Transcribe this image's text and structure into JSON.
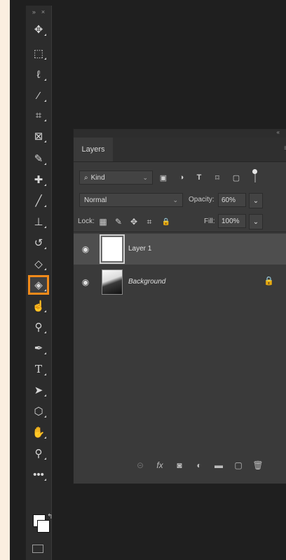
{
  "toolbar": {
    "collapse_glyph": "»",
    "close_glyph": "×",
    "tools": [
      {
        "name": "move-tool",
        "icon": "move-icon",
        "glyph": "✥"
      },
      {
        "name": "marquee-tool",
        "icon": "marquee-icon",
        "glyph": "⬚"
      },
      {
        "name": "lasso-tool",
        "icon": "lasso-icon",
        "glyph": "ℓ"
      },
      {
        "name": "magic-wand-tool",
        "icon": "magic-wand-icon",
        "glyph": "⁄"
      },
      {
        "name": "crop-tool",
        "icon": "crop-icon",
        "glyph": "⌗"
      },
      {
        "name": "frame-tool",
        "icon": "frame-icon",
        "glyph": "⊠"
      },
      {
        "name": "eyedropper-tool",
        "icon": "eyedropper-icon",
        "glyph": "✎"
      },
      {
        "name": "healing-brush-tool",
        "icon": "bandage-icon",
        "glyph": "✚"
      },
      {
        "name": "brush-tool",
        "icon": "brush-icon",
        "glyph": "╱"
      },
      {
        "name": "clone-stamp-tool",
        "icon": "stamp-icon",
        "glyph": "⊥"
      },
      {
        "name": "history-brush-tool",
        "icon": "history-brush-icon",
        "glyph": "↺"
      },
      {
        "name": "eraser-tool",
        "icon": "eraser-icon",
        "glyph": "◇"
      },
      {
        "name": "paint-bucket-tool",
        "icon": "paint-bucket-icon",
        "glyph": "◈",
        "active": true
      },
      {
        "name": "smudge-tool",
        "icon": "smudge-icon",
        "glyph": "☝"
      },
      {
        "name": "dodge-tool",
        "icon": "dodge-icon",
        "glyph": "⚲"
      },
      {
        "name": "pen-tool",
        "icon": "pen-icon",
        "glyph": "✒"
      },
      {
        "name": "type-tool",
        "icon": "type-icon",
        "glyph": "T"
      },
      {
        "name": "path-selection-tool",
        "icon": "arrow-icon",
        "glyph": "➤"
      },
      {
        "name": "shape-tool",
        "icon": "hexagon-icon",
        "glyph": "⬡"
      },
      {
        "name": "hand-tool",
        "icon": "hand-icon",
        "glyph": "✋"
      },
      {
        "name": "zoom-tool",
        "icon": "zoom-icon",
        "glyph": "⚲"
      },
      {
        "name": "more-tools",
        "icon": "ellipsis-icon",
        "glyph": "•••"
      }
    ],
    "accent": "#f08a1a"
  },
  "panel": {
    "collapse_glyph": "«",
    "menu_glyph": "≡",
    "tab_label": "Layers",
    "filter": {
      "kind_label": "Kind",
      "search_glyph": "⌕",
      "chevron": "⌄",
      "icons": [
        "image-filter-icon",
        "adjustment-filter-icon",
        "type-filter-icon",
        "shape-filter-icon",
        "smart-object-filter-icon"
      ],
      "glyphs": [
        "▣",
        "◑",
        "T",
        "⌑",
        "▢"
      ]
    },
    "blend": {
      "mode": "Normal",
      "opacity_label": "Opacity:",
      "opacity_value": "60%"
    },
    "lock": {
      "label": "Lock:",
      "fill_label": "Fill:",
      "fill_value": "100%",
      "glyphs": [
        "▦",
        "✎",
        "✥",
        "⌗",
        "🔒"
      ]
    },
    "layers": [
      {
        "name": "Layer 1",
        "selected": true
      },
      {
        "name": "Background",
        "selected": false,
        "locked": true
      }
    ],
    "footer_glyphs": [
      "⊝",
      "fx",
      "◙",
      "◐",
      "▬",
      "▢",
      "🗑"
    ]
  }
}
